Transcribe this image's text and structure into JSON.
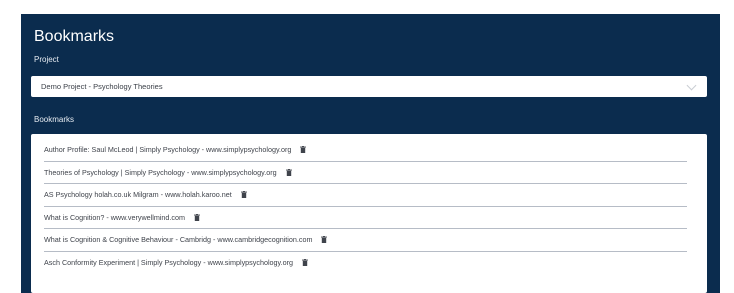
{
  "title": "Bookmarks",
  "project": {
    "label": "Project",
    "selected": "Demo Project - Psychology Theories",
    "icon": "chevron-down-icon"
  },
  "bookmarks": {
    "label": "Bookmarks",
    "items": [
      {
        "text": "Author Profile: Saul McLeod | Simply Psychology - www.simplypsychology.org",
        "icon": "trash-icon"
      },
      {
        "text": "Theories of Psychology | Simply Psychology - www.simplypsychology.org",
        "icon": "trash-icon"
      },
      {
        "text": "AS Psychology holah.co.uk Milgram - www.holah.karoo.net",
        "icon": "trash-icon"
      },
      {
        "text": "What is Cognition? - www.verywellmind.com",
        "icon": "trash-icon"
      },
      {
        "text": "What is Cognition & Cognitive Behaviour - Cambridg - www.cambridgecognition.com",
        "icon": "trash-icon"
      },
      {
        "text": "Asch Conformity Experiment | Simply Psychology - www.simplypsychology.org",
        "icon": "trash-icon"
      }
    ]
  },
  "colors": {
    "panel_bg": "#0b2c4e",
    "text_on_panel": "#ffffff",
    "item_text": "#3f434b",
    "divider": "#b6bcc6"
  }
}
